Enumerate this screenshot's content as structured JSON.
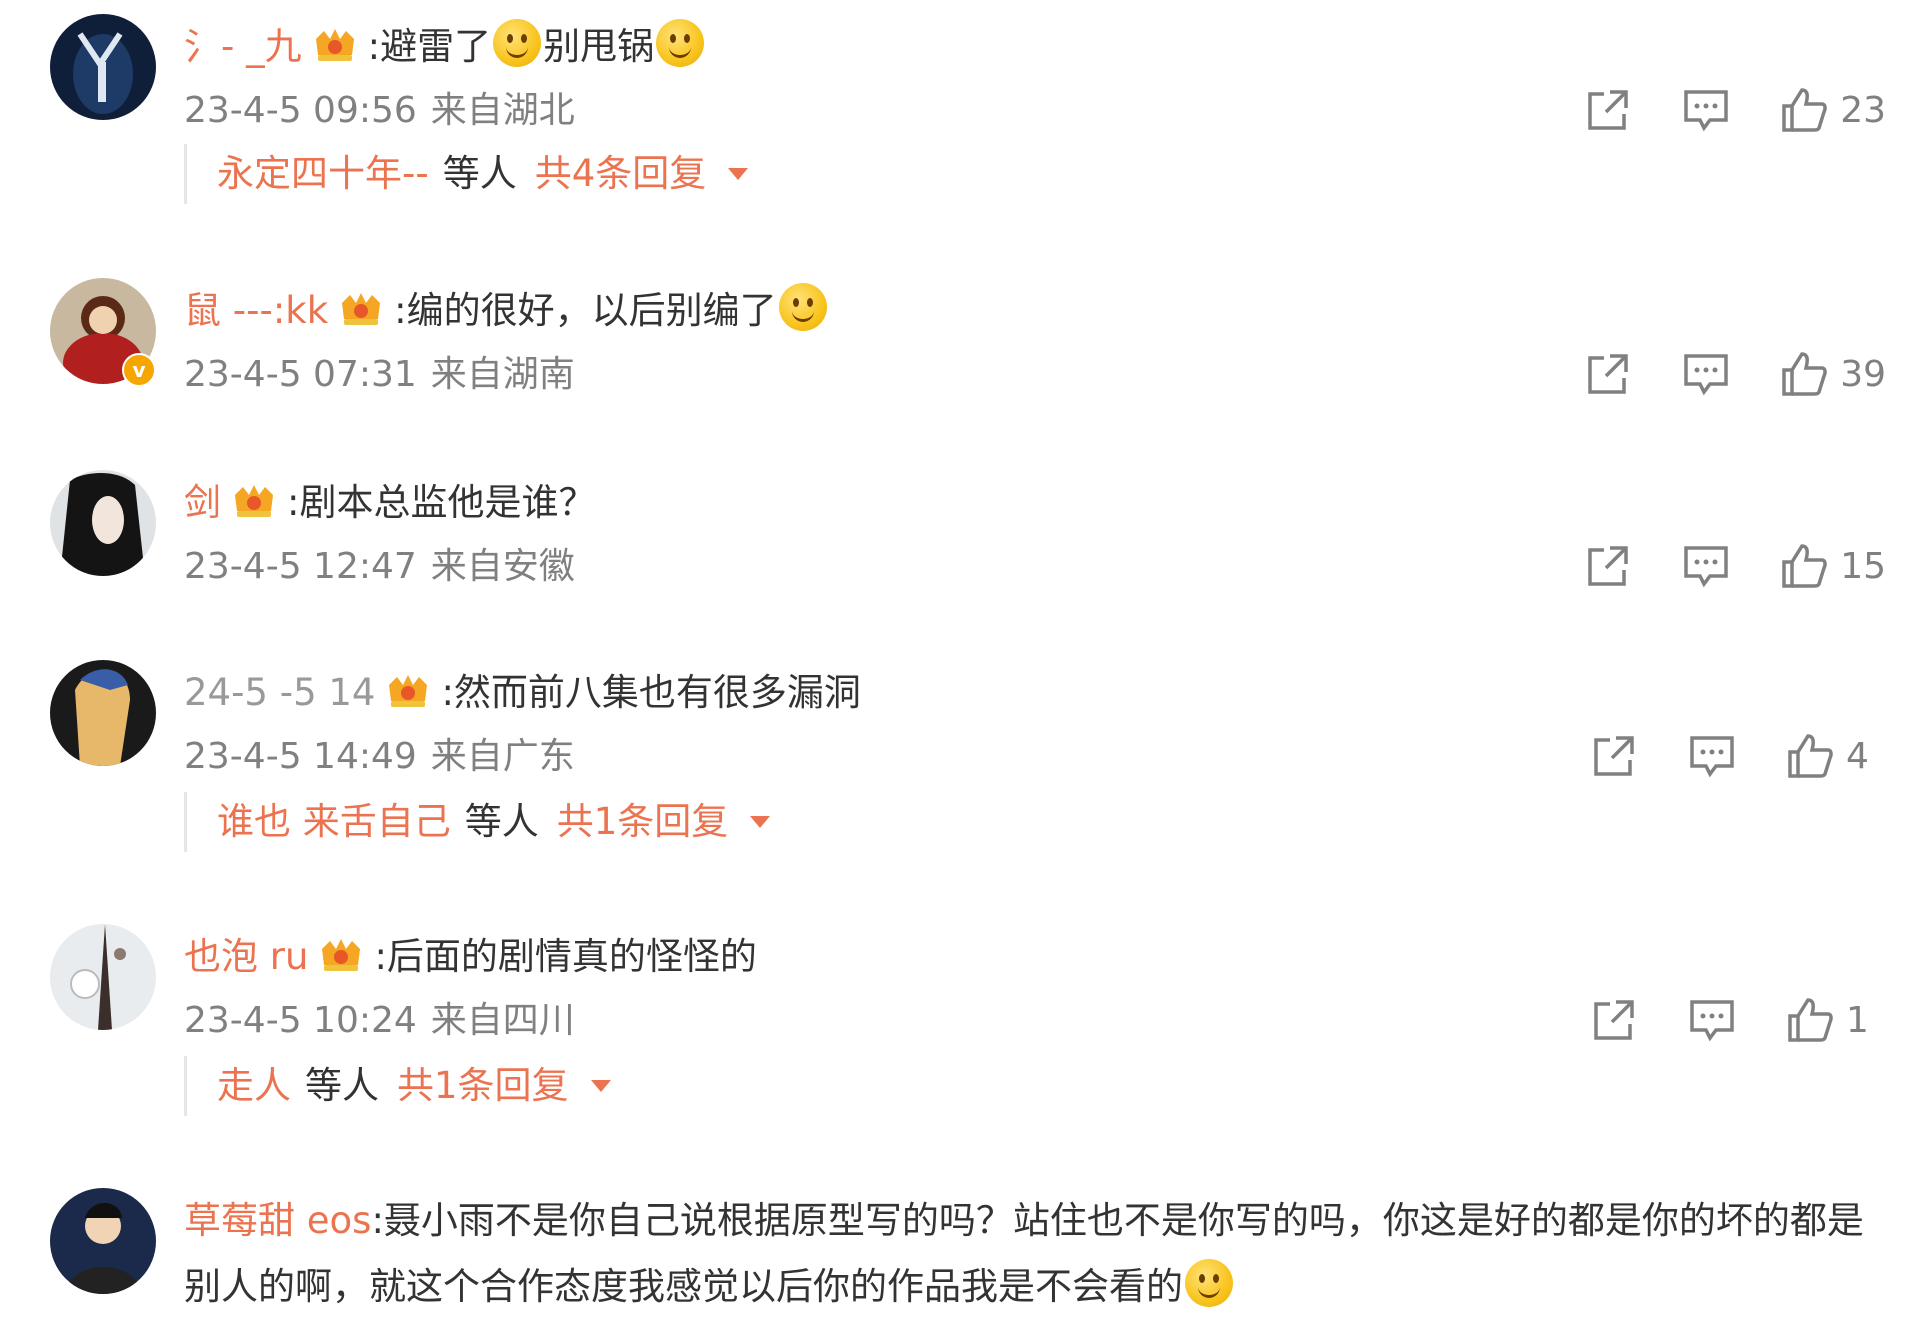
{
  "comments": [
    {
      "username": "氵- _九",
      "text_parts": [
        ":避雷了",
        "别甩锅"
      ],
      "time": "23-4-5 09:56",
      "location": "来自湖北",
      "likes": "23",
      "reply_summary": {
        "names": "永定四十年--",
        "etc": "等人",
        "total": "共4条回复"
      }
    },
    {
      "username": "鼠 ---:kk",
      "text_parts": [
        ":编的很好，以后别编了"
      ],
      "time": "23-4-5 07:31",
      "location": "来自湖南",
      "likes": "39"
    },
    {
      "username": "剑",
      "text_parts": [
        ":剧本总监他是谁？"
      ],
      "time": "23-4-5 12:47",
      "location": "来自安徽",
      "likes": "15"
    },
    {
      "username": "24-5 -5 14",
      "text_parts": [
        ":然而前八集也有很多漏洞"
      ],
      "time": "23-4-5 14:49",
      "location": "来自广东",
      "likes": "4",
      "reply_summary": {
        "names": "谁也 来舌自己",
        "etc": "等人",
        "total": "共1条回复"
      }
    },
    {
      "username": "也泡 ru",
      "text_parts": [
        ":后面的剧情真的怪怪的"
      ],
      "time": "23-4-5 10:24",
      "location": "来自四川",
      "likes": "1",
      "reply_summary": {
        "names": "走人",
        "etc": "等人",
        "total": "共1条回复"
      }
    },
    {
      "username": "草莓甜 eos",
      "text_parts": [
        ":聂小雨不是你自己说根据原型写的吗？站住也不是你写的吗，你这是好的都是你的坏的都是别人的啊，就这个合作态度我感觉以后你的作品我是不会看的"
      ]
    }
  ],
  "icons": {
    "share": "share-icon",
    "reply": "comment-icon",
    "like": "thumbs-up-icon",
    "member": "crown-badge-icon",
    "emoji": "smile-emoji-icon"
  },
  "colors": {
    "username": "#eb7350",
    "meta": "#808080",
    "text": "#333333"
  }
}
